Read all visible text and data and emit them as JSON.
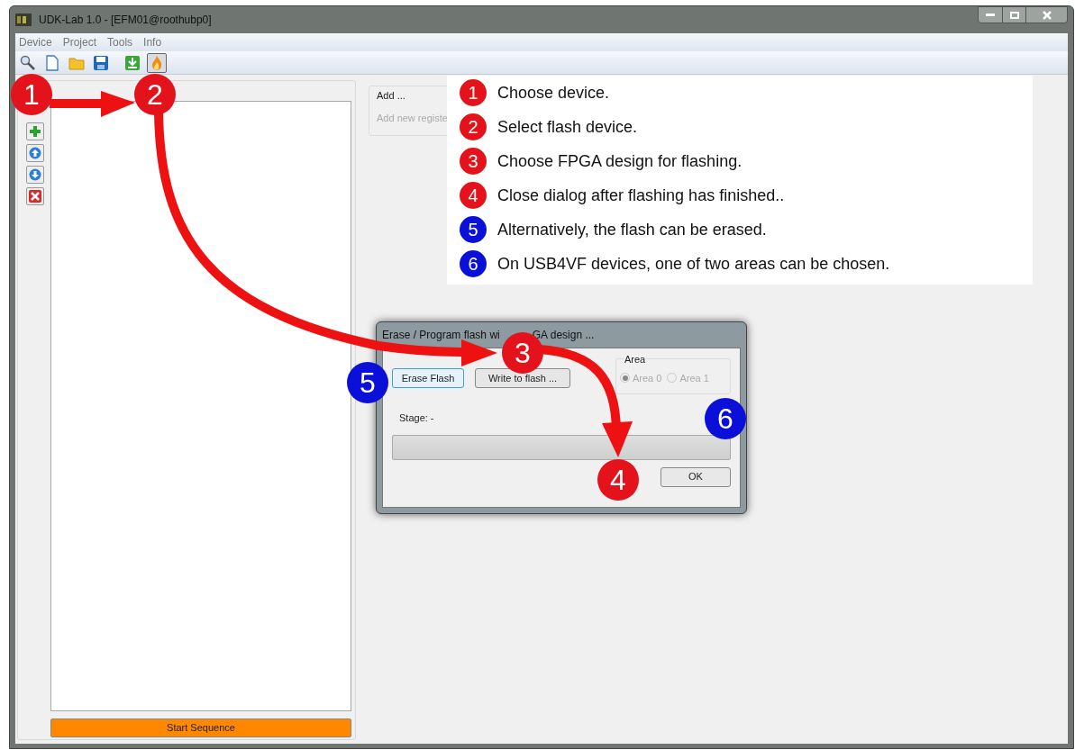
{
  "window": {
    "title": "UDK-Lab 1.0 - [EFM01@roothubp0]"
  },
  "menu": [
    "Device",
    "Project",
    "Tools",
    "Info"
  ],
  "toolbar": [
    {
      "kind": "search",
      "selected": false
    },
    {
      "kind": "new",
      "selected": false
    },
    {
      "kind": "open",
      "selected": false
    },
    {
      "kind": "save",
      "selected": false
    },
    {
      "kind": "download",
      "selected": false
    },
    {
      "kind": "flame",
      "selected": true
    }
  ],
  "side_buttons": [
    {
      "kind": "add"
    },
    {
      "kind": "up"
    },
    {
      "kind": "down"
    },
    {
      "kind": "delete"
    }
  ],
  "start_button": "Start Sequence",
  "add_group": {
    "title": "Add ...",
    "placeholder": "Add new registe"
  },
  "callouts": [
    {
      "number": "1",
      "color": "#e3121b",
      "text": "Choose device."
    },
    {
      "number": "2",
      "color": "#e3121b",
      "text": "Select flash device."
    },
    {
      "number": "3",
      "color": "#e3121b",
      "text": "Choose FPGA design for flashing."
    },
    {
      "number": "4",
      "color": "#e3121b",
      "text": "Close dialog after flashing has finished.."
    },
    {
      "number": "5",
      "color": "#0a10d8",
      "text": "Alternatively, the flash can be erased."
    },
    {
      "number": "6",
      "color": "#0a10d8",
      "text": "On USB4VF devices, one of two areas can be chosen."
    }
  ],
  "markers": [
    {
      "number": "1",
      "color": "#e3121b"
    },
    {
      "number": "2",
      "color": "#e3121b"
    },
    {
      "number": "3",
      "color": "#e3121b"
    },
    {
      "number": "4",
      "color": "#e3121b"
    },
    {
      "number": "5",
      "color": "#0a10d8"
    },
    {
      "number": "6",
      "color": "#0a10d8"
    }
  ],
  "dialog": {
    "title": "Erase / Program flash wi",
    "title_rest": "GA design ...",
    "erase_button": "Erase Flash",
    "write_button": "Write to flash ...",
    "area_title": "Area",
    "areas": [
      {
        "label": "Area 0",
        "selected": true,
        "disabled": true
      },
      {
        "label": "Area 1",
        "selected": false,
        "disabled": true
      }
    ],
    "stage": "Stage: -",
    "progress": {
      "level": 0
    },
    "ok_button": "OK"
  }
}
